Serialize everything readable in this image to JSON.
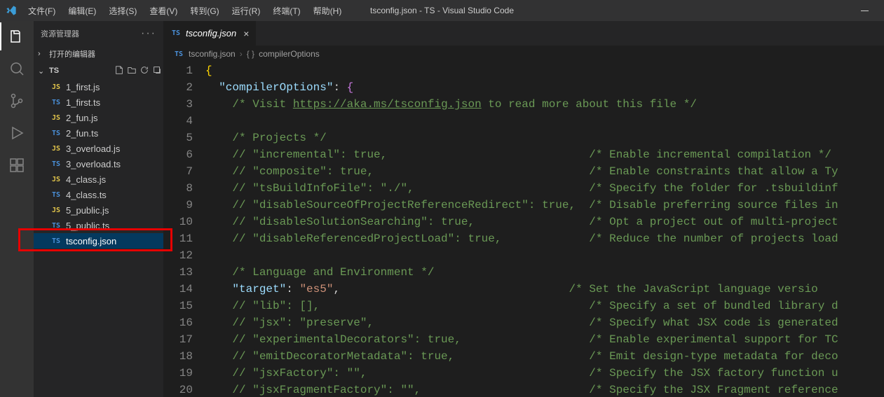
{
  "titlebar": {
    "title": "tsconfig.json - TS - Visual Studio Code",
    "menus": [
      "文件(F)",
      "编辑(E)",
      "选择(S)",
      "查看(V)",
      "转到(G)",
      "运行(R)",
      "终端(T)",
      "帮助(H)"
    ]
  },
  "activitybar": {
    "items": [
      "explorer",
      "search",
      "scm",
      "run-debug",
      "extensions"
    ]
  },
  "sidebar": {
    "title": "资源管理器",
    "openEditors": "打开的编辑器",
    "folder": "TS",
    "files": [
      {
        "icon": "js",
        "name": "1_first.js"
      },
      {
        "icon": "ts",
        "name": "1_first.ts"
      },
      {
        "icon": "js",
        "name": "2_fun.js"
      },
      {
        "icon": "ts",
        "name": "2_fun.ts"
      },
      {
        "icon": "js",
        "name": "3_overload.js"
      },
      {
        "icon": "ts",
        "name": "3_overload.ts"
      },
      {
        "icon": "js",
        "name": "4_class.js"
      },
      {
        "icon": "ts",
        "name": "4_class.ts"
      },
      {
        "icon": "js",
        "name": "5_public.js"
      },
      {
        "icon": "ts",
        "name": "5_public.ts"
      },
      {
        "icon": "ts",
        "name": "tsconfig.json",
        "selected": true
      }
    ]
  },
  "tabs": {
    "active": {
      "icon": "ts",
      "label": "tsconfig.json"
    }
  },
  "breadcrumbs": {
    "tsicon": "TS",
    "file": "tsconfig.json",
    "brace": "{ }",
    "node": "compilerOptions"
  },
  "code": {
    "lines": [
      {
        "n": 1,
        "html": "<span class='c-brace'>{</span>"
      },
      {
        "n": 2,
        "html": "  <span class='c-key'>\"compilerOptions\"</span><span class='c-colon'>:</span> <span class='c-brace2'>{</span>"
      },
      {
        "n": 3,
        "html": "    <span class='c-comment'>/* Visit </span><span class='c-link'>https://aka.ms/tsconfig.json</span><span class='c-comment'> to read more about this file */</span>"
      },
      {
        "n": 4,
        "html": ""
      },
      {
        "n": 5,
        "html": "    <span class='c-comment'>/* Projects */</span>"
      },
      {
        "n": 6,
        "html": "    <span class='c-comment'>// \"incremental\": true,                              /* Enable incremental compilation */</span>"
      },
      {
        "n": 7,
        "html": "    <span class='c-comment'>// \"composite\": true,                                /* Enable constraints that allow a Ty</span>"
      },
      {
        "n": 8,
        "html": "    <span class='c-comment'>// \"tsBuildInfoFile\": \"./\",                          /* Specify the folder for .tsbuildinf</span>"
      },
      {
        "n": 9,
        "html": "    <span class='c-comment'>// \"disableSourceOfProjectReferenceRedirect\": true,  /* Disable preferring source files in</span>"
      },
      {
        "n": 10,
        "html": "    <span class='c-comment'>// \"disableSolutionSearching\": true,                 /* Opt a project out of multi-project</span>"
      },
      {
        "n": 11,
        "html": "    <span class='c-comment'>// \"disableReferencedProjectLoad\": true,             /* Reduce the number of projects load</span>"
      },
      {
        "n": 12,
        "html": ""
      },
      {
        "n": 13,
        "html": "    <span class='c-comment'>/* Language and Environment */</span>"
      },
      {
        "n": 14,
        "html": "    <span class='c-key'>\"target\"</span><span class='c-colon'>:</span> <span class='c-str'>\"es5\"</span><span class='c-colon'>,</span>                                  <span class='c-comment'>/* Set the JavaScript language versio</span>"
      },
      {
        "n": 15,
        "html": "    <span class='c-comment'>// \"lib\": [],                                        /* Specify a set of bundled library d</span>"
      },
      {
        "n": 16,
        "html": "    <span class='c-comment'>// \"jsx\": \"preserve\",                                /* Specify what JSX code is generated</span>"
      },
      {
        "n": 17,
        "html": "    <span class='c-comment'>// \"experimentalDecorators\": true,                   /* Enable experimental support for TC</span>"
      },
      {
        "n": 18,
        "html": "    <span class='c-comment'>// \"emitDecoratorMetadata\": true,                    /* Emit design-type metadata for deco</span>"
      },
      {
        "n": 19,
        "html": "    <span class='c-comment'>// \"jsxFactory\": \"\",                                 /* Specify the JSX factory function u</span>"
      },
      {
        "n": 20,
        "html": "    <span class='c-comment'>// \"jsxFragmentFactory\": \"\",                         /* Specify the JSX Fragment reference</span>"
      }
    ]
  }
}
